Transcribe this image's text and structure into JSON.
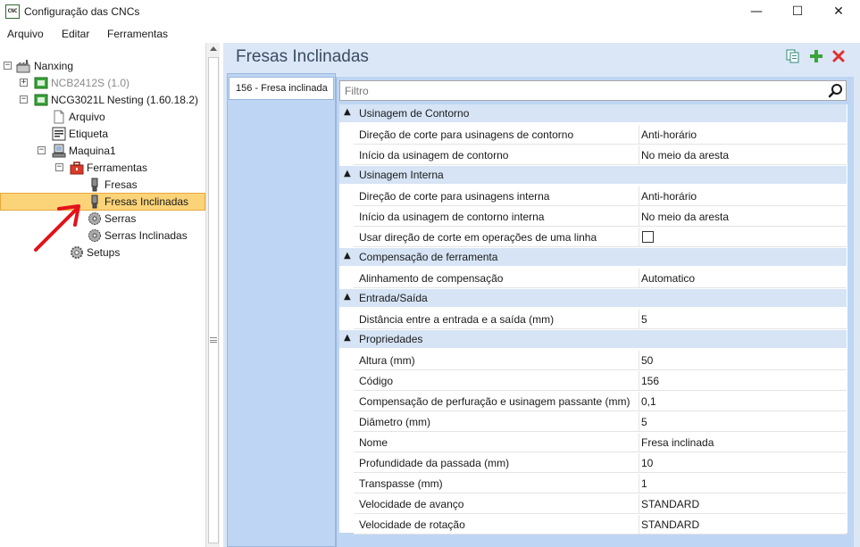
{
  "window": {
    "title": "Configuração das CNCs",
    "app_icon_text": "CNC",
    "minimize": "—",
    "maximize": "☐",
    "close": "✕"
  },
  "menu": [
    "Arquivo",
    "Editar",
    "Ferramentas"
  ],
  "tree": {
    "root": "Nanxing",
    "machine1": "NCB2412S (1.0)",
    "machine2": "NCG3021L Nesting (1.60.18.2)",
    "arquivo": "Arquivo",
    "etiqueta": "Etiqueta",
    "maquina": "Maquina1",
    "ferramentas": "Ferramentas",
    "fresas": "Fresas",
    "fresas_inclinadas": "Fresas Inclinadas",
    "serras": "Serras",
    "serras_inclinadas": "Serras Inclinadas",
    "setups": "Setups"
  },
  "panel": {
    "title": "Fresas Inclinadas",
    "tab": "156 - Fresa inclinada",
    "filter_placeholder": "Filtro"
  },
  "categories": [
    {
      "label": "Usinagem de Contorno",
      "props": [
        {
          "name": "Direção de corte para usinagens de contorno",
          "value": "Anti-horário"
        },
        {
          "name": "Início da usinagem de contorno",
          "value": "No meio da aresta"
        }
      ]
    },
    {
      "label": "Usinagem Interna",
      "props": [
        {
          "name": "Direção de corte para usinagens interna",
          "value": "Anti-horário"
        },
        {
          "name": "Início da usinagem de contorno interna",
          "value": "No meio da aresta"
        },
        {
          "name": "Usar direção de corte em operações de uma linha",
          "value": ""
        }
      ]
    },
    {
      "label": "Compensação de ferramenta",
      "props": [
        {
          "name": "Alinhamento de compensação",
          "value": "Automatico"
        }
      ]
    },
    {
      "label": "Entrada/Saída",
      "props": [
        {
          "name": "Distância entre a entrada e a saída (mm)",
          "value": "5"
        }
      ]
    },
    {
      "label": "Propriedades",
      "props": [
        {
          "name": "Altura (mm)",
          "value": "50"
        },
        {
          "name": "Código",
          "value": "156"
        },
        {
          "name": "Compensação de perfuração e usinagem passante (mm)",
          "value": "0,1"
        },
        {
          "name": "Diâmetro (mm)",
          "value": "5"
        },
        {
          "name": "Nome",
          "value": "Fresa inclinada"
        },
        {
          "name": "Profundidade da passada (mm)",
          "value": "10"
        },
        {
          "name": "Transpasse (mm)",
          "value": "1"
        },
        {
          "name": "Velocidade de avanço",
          "value": "STANDARD"
        },
        {
          "name": "Velocidade de rotação",
          "value": "STANDARD"
        }
      ]
    }
  ],
  "icons": {
    "copy": "copy-icon",
    "add": "add-icon",
    "delete": "delete-icon",
    "search": "search-icon"
  },
  "colors": {
    "selection": "#fbd378",
    "panel_bg": "#dbe7f7",
    "category_bg": "#d6e4f5",
    "add_green": "#3aa33a",
    "delete_red": "#e03030",
    "annotation_red": "#e3121b"
  }
}
